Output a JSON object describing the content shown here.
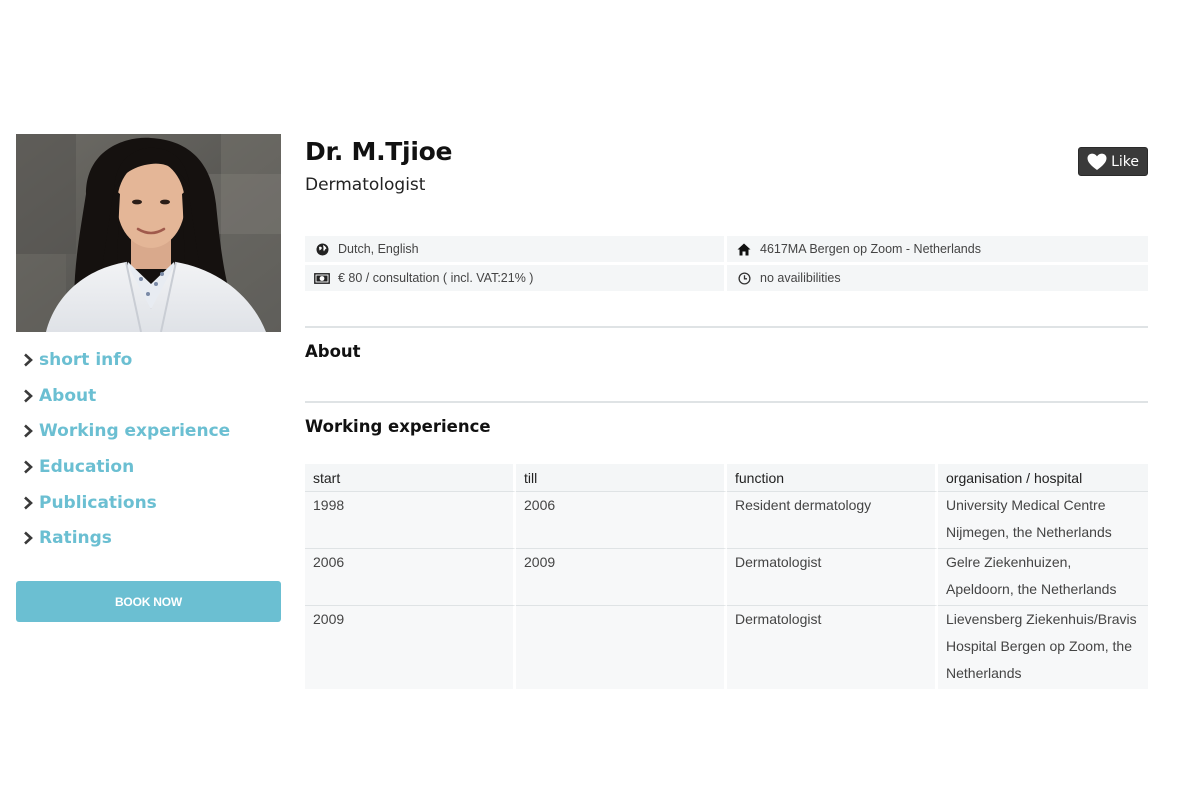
{
  "profile": {
    "name": "Dr. M.Tjioe",
    "specialty": "Dermatologist",
    "like_label": "Like"
  },
  "info": {
    "languages": "Dutch, English",
    "location": "4617MA Bergen op Zoom - Netherlands",
    "price": "€ 80 / consultation ( incl. VAT:21% )",
    "availability": "no availibilities"
  },
  "sidebar": {
    "items": [
      {
        "label": "short info",
        "icon": "chevron-right-icon"
      },
      {
        "label": "About",
        "icon": "chevron-right-icon"
      },
      {
        "label": "Working experience",
        "icon": "chevron-right-icon"
      },
      {
        "label": "Education",
        "icon": "chevron-right-icon"
      },
      {
        "label": "Publications",
        "icon": "chevron-right-icon"
      },
      {
        "label": "Ratings",
        "icon": "chevron-right-icon"
      }
    ],
    "book_label": "BOOK NOW"
  },
  "sections": {
    "about_title": "About",
    "experience_title": "Working experience"
  },
  "experience": {
    "headers": [
      "start",
      "till",
      "function",
      "organisation / hospital"
    ],
    "rows": [
      [
        "1998",
        "2006",
        "Resident dermatology",
        "University Medical Centre Nijmegen, the Netherlands"
      ],
      [
        "2006",
        "2009",
        "Dermatologist",
        "Gelre Ziekenhuizen, Apeldoorn, the Netherlands"
      ],
      [
        "2009",
        "",
        "Dermatologist",
        "Lievensberg Ziekenhuis/Bravis Hospital Bergen op Zoom, the Netherlands"
      ]
    ]
  },
  "colors": {
    "accent": "#6bbfd2",
    "like_bg": "#3a3a3a",
    "cell_bg": "#f4f6f7"
  },
  "icons": {
    "languages": "globe-icon",
    "location": "home-icon",
    "price": "money-icon",
    "availability": "clock-icon",
    "like": "heart-icon"
  }
}
